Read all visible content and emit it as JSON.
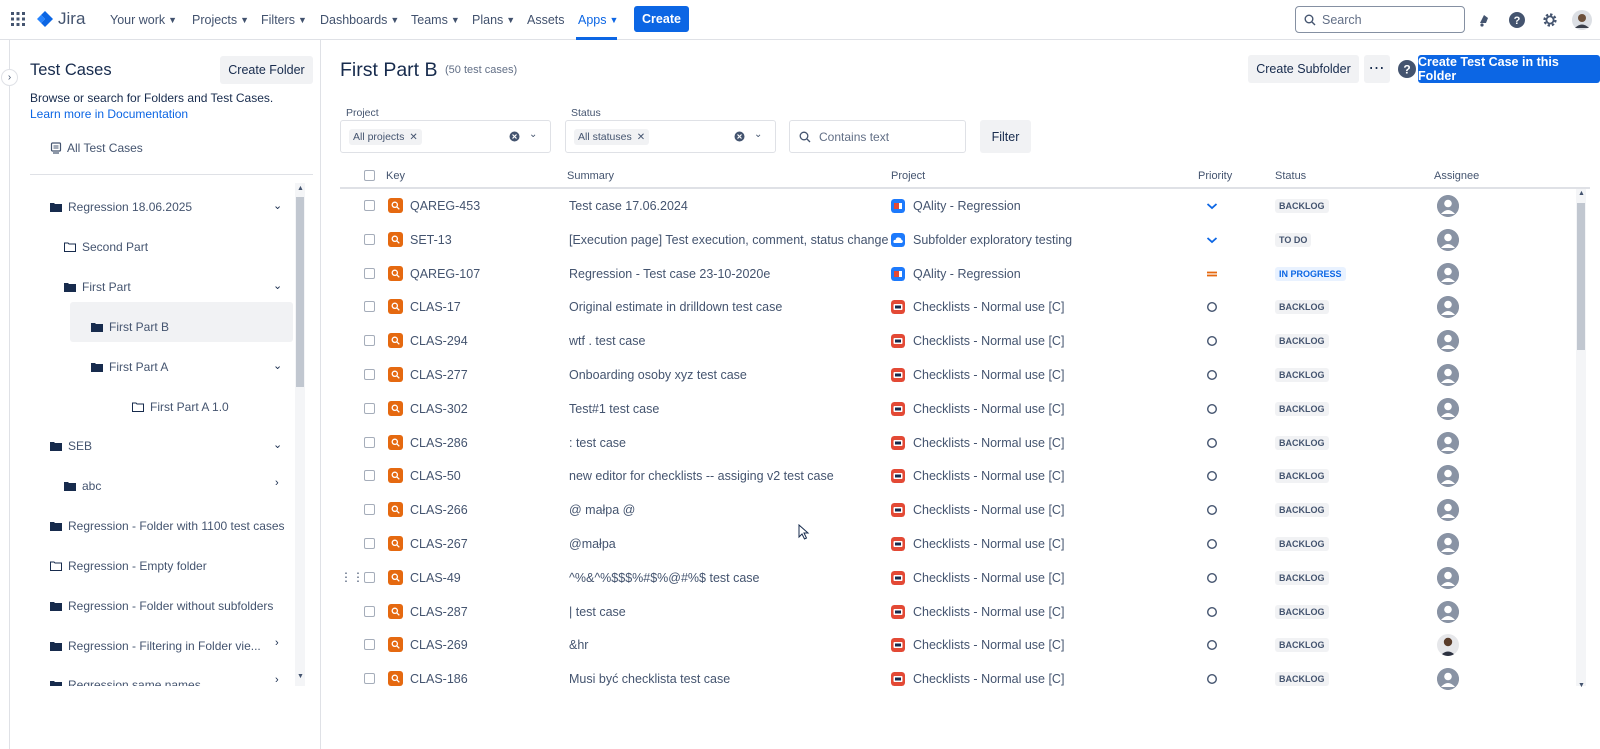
{
  "nav": {
    "logo_text": "Jira",
    "items": [
      {
        "label": "Your work"
      },
      {
        "label": "Projects"
      },
      {
        "label": "Filters"
      },
      {
        "label": "Dashboards"
      },
      {
        "label": "Teams"
      },
      {
        "label": "Plans"
      },
      {
        "label": "Assets"
      },
      {
        "label": "Apps"
      }
    ],
    "create_label": "Create",
    "search_placeholder": "Search"
  },
  "sidebar": {
    "title": "Test Cases",
    "create_folder_label": "Create Folder",
    "description": "Browse or search for Folders and Test Cases.",
    "doc_link": "Learn more in Documentation",
    "all_test_cases": "All Test Cases",
    "tree": [
      {
        "label": "Regression 18.06.2025"
      },
      {
        "label": "Second Part"
      },
      {
        "label": "First Part"
      },
      {
        "label": "First Part B"
      },
      {
        "label": "First Part A"
      },
      {
        "label": "First Part A 1.0"
      },
      {
        "label": "SEB"
      },
      {
        "label": "abc"
      },
      {
        "label": "Regression - Folder with 1100 test cases"
      },
      {
        "label": "Regression - Empty folder"
      },
      {
        "label": "Regression - Folder without subfolders"
      },
      {
        "label": "Regression - Filtering in Folder vie..."
      },
      {
        "label": "Regression same names"
      }
    ]
  },
  "main": {
    "title": "First Part B",
    "count": "(50 test cases)",
    "create_subfolder_label": "Create Subfolder",
    "create_test_case_label": "Create Test Case in this Folder",
    "filters": {
      "project_label": "Project",
      "project_chip": "All projects",
      "status_label": "Status",
      "status_chip": "All statuses",
      "text_placeholder": "Contains text",
      "filter_button": "Filter"
    },
    "columns": {
      "key": "Key",
      "summary": "Summary",
      "project": "Project",
      "priority": "Priority",
      "status": "Status",
      "assignee": "Assignee"
    },
    "rows": [
      {
        "key": "QAREG-453",
        "summary": "Test case 17.06.2024",
        "project": "QAlity - Regression",
        "status": "BACKLOG"
      },
      {
        "key": "SET-13",
        "summary": "[Execution page] Test execution, comment, status change",
        "project": "Subfolder exploratory testing",
        "status": "TO DO"
      },
      {
        "key": "QAREG-107",
        "summary": "Regression - Test case 23-10-2020e",
        "project": "QAlity - Regression",
        "status": "IN PROGRESS"
      },
      {
        "key": "CLAS-17",
        "summary": "Original estimate in drilldown test case",
        "project": "Checklists - Normal use [C]",
        "status": "BACKLOG"
      },
      {
        "key": "CLAS-294",
        "summary": "wtf . test case",
        "project": "Checklists - Normal use [C]",
        "status": "BACKLOG"
      },
      {
        "key": "CLAS-277",
        "summary": "Onboarding osoby xyz test case",
        "project": "Checklists - Normal use [C]",
        "status": "BACKLOG"
      },
      {
        "key": "CLAS-302",
        "summary": "Test#1 test case",
        "project": "Checklists - Normal use [C]",
        "status": "BACKLOG"
      },
      {
        "key": "CLAS-286",
        "summary": ": test case",
        "project": "Checklists - Normal use [C]",
        "status": "BACKLOG"
      },
      {
        "key": "CLAS-50",
        "summary": "new editor for checklists -- assiging v2 test case",
        "project": "Checklists - Normal use [C]",
        "status": "BACKLOG"
      },
      {
        "key": "CLAS-266",
        "summary": "@ małpa @",
        "project": "Checklists - Normal use [C]",
        "status": "BACKLOG"
      },
      {
        "key": "CLAS-267",
        "summary": "@małpa",
        "project": "Checklists - Normal use [C]",
        "status": "BACKLOG"
      },
      {
        "key": "CLAS-49",
        "summary": "^%&^%$$$%#$%@#%$ test case",
        "project": "Checklists - Normal use [C]",
        "status": "BACKLOG"
      },
      {
        "key": "CLAS-287",
        "summary": "| test case",
        "project": "Checklists - Normal use [C]",
        "status": "BACKLOG"
      },
      {
        "key": "CLAS-269",
        "summary": "&hr",
        "project": "Checklists - Normal use [C]",
        "status": "BACKLOG"
      },
      {
        "key": "CLAS-186",
        "summary": "Musi być checklista test case",
        "project": "Checklists - Normal use [C]",
        "status": "BACKLOG"
      }
    ]
  },
  "colors": {
    "brand_blue": "#0c66e4",
    "test_icon": "#e56910",
    "priority_low": "#0c66e4",
    "priority_medium": "#e56910",
    "status_grey_bg": "#f1f2f4",
    "status_blue_bg": "#e9f2ff"
  }
}
